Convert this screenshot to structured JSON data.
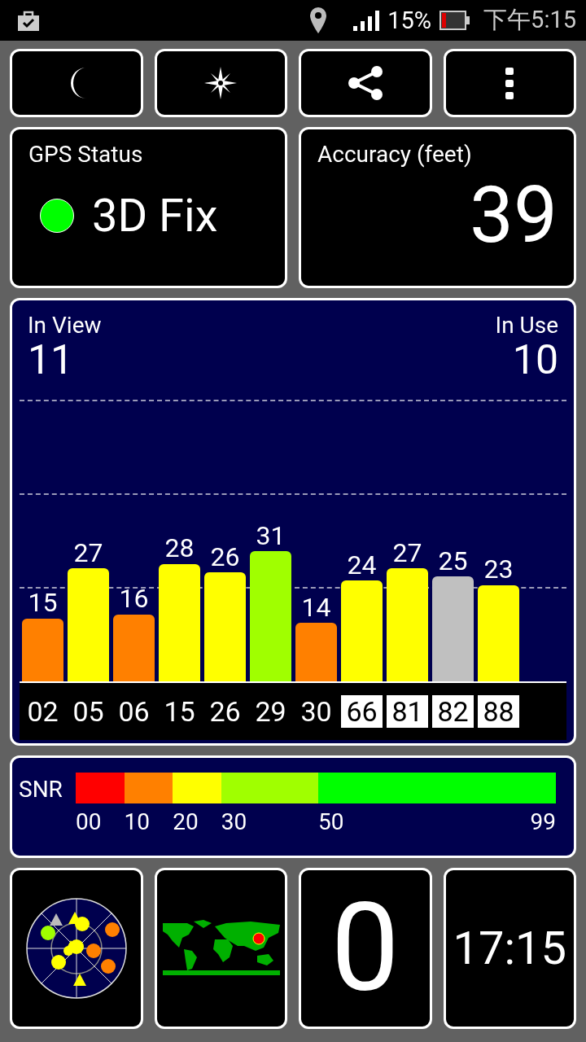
{
  "status_bar": {
    "battery": "15%",
    "time": "下午5:15"
  },
  "toolbar": [
    {
      "kind": "moon"
    },
    {
      "kind": "compass"
    },
    {
      "kind": "share"
    },
    {
      "kind": "menu"
    }
  ],
  "gps_status": {
    "title": "GPS Status",
    "value": "3D Fix",
    "color": "#00ff00"
  },
  "accuracy": {
    "title": "Accuracy (feet)",
    "value": "39"
  },
  "satellites_panel": {
    "in_view_label": "In View",
    "in_view": "11",
    "in_use_label": "In Use",
    "in_use": "10",
    "satellites": [
      {
        "id": "02",
        "snr": "15",
        "color": "#ff8000",
        "boxed": false
      },
      {
        "id": "05",
        "snr": "27",
        "color": "#ffff00",
        "boxed": false
      },
      {
        "id": "06",
        "snr": "16",
        "color": "#ff8000",
        "boxed": false
      },
      {
        "id": "15",
        "snr": "28",
        "color": "#ffff00",
        "boxed": false
      },
      {
        "id": "26",
        "snr": "26",
        "color": "#ffff00",
        "boxed": false
      },
      {
        "id": "29",
        "snr": "31",
        "color": "#a0ff00",
        "boxed": false
      },
      {
        "id": "30",
        "snr": "14",
        "color": "#ff8000",
        "boxed": false
      },
      {
        "id": "66",
        "snr": "24",
        "color": "#ffff00",
        "boxed": true
      },
      {
        "id": "81",
        "snr": "27",
        "color": "#ffff00",
        "boxed": true
      },
      {
        "id": "82",
        "snr": "25",
        "color": "#c0c0c0",
        "boxed": true
      },
      {
        "id": "88",
        "snr": "23",
        "color": "#ffff00",
        "boxed": true
      }
    ]
  },
  "snr_legend": {
    "label": "SNR",
    "end": "99",
    "segments": [
      {
        "from": "00",
        "color": "#ff0000"
      },
      {
        "from": "10",
        "color": "#ff8000"
      },
      {
        "from": "20",
        "color": "#ffff00"
      },
      {
        "from": "30",
        "color": "#a0ff00"
      },
      {
        "from": "50",
        "color": "#00ff00"
      }
    ]
  },
  "bottom_tiles": [
    {
      "kind": "skyplot"
    },
    {
      "kind": "map"
    },
    {
      "kind": "counter",
      "value": "0"
    },
    {
      "kind": "clock",
      "value": "17:15"
    }
  ]
}
